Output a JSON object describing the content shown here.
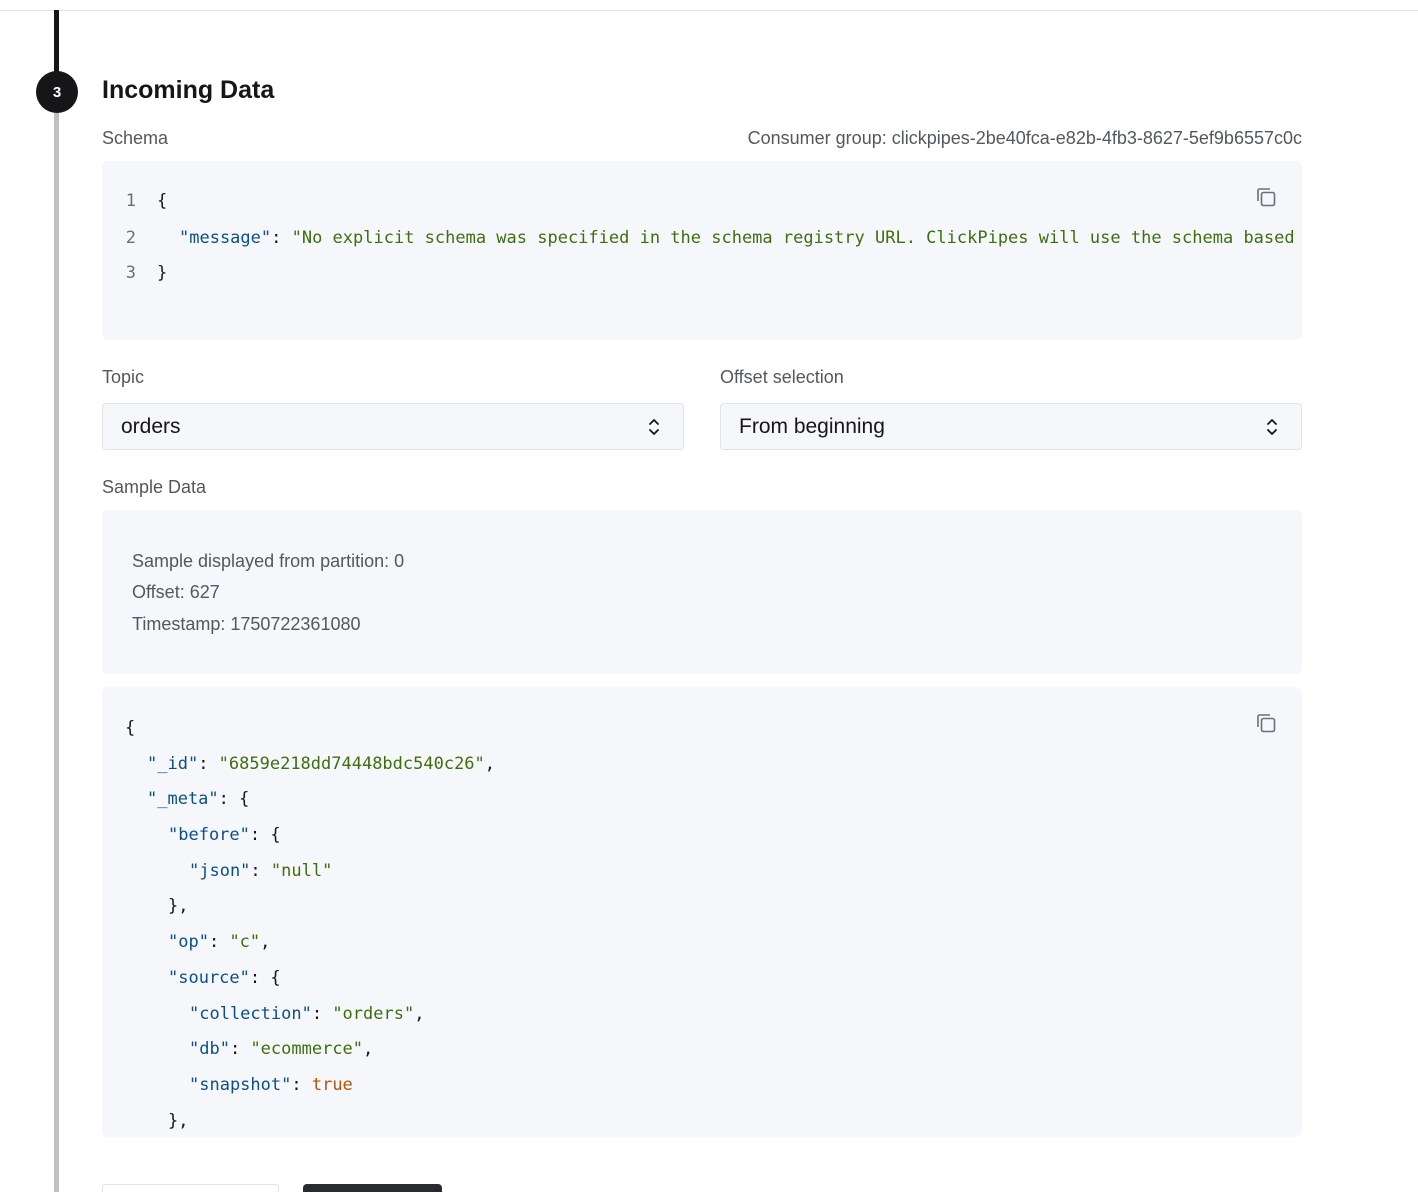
{
  "step": {
    "number": "3",
    "title": "Incoming Data"
  },
  "schema": {
    "label": "Schema",
    "consumer_group": "Consumer group: clickpipes-2be40fca-e82b-4fb3-8627-5ef9b6557c0c",
    "line_numbers": [
      "1",
      "2",
      "3"
    ],
    "open_brace": "{",
    "key": "\"message\"",
    "value": "\"No explicit schema was specified in the schema registry URL. ClickPipes will use the schema based on the sample data.\"",
    "close_brace": "}"
  },
  "topic": {
    "label": "Topic",
    "selected": "orders"
  },
  "offset": {
    "label": "Offset selection",
    "selected": "From beginning"
  },
  "sample": {
    "label": "Sample Data",
    "partition": "Sample displayed from partition: 0",
    "offset": "Offset: 627",
    "timestamp": "Timestamp: 1750722361080"
  },
  "sample_json": {
    "open": "{",
    "id_key": "\"_id\"",
    "id_value": "\"6859e218dd74448bdc540c26\"",
    "meta_key": "\"_meta\"",
    "before_key": "\"before\"",
    "json_key": "\"json\"",
    "json_value": "\"null\"",
    "close_obj_comma": "},",
    "op_key": "\"op\"",
    "op_value": "\"c\"",
    "source_key": "\"source\"",
    "collection_key": "\"collection\"",
    "collection_value": "\"orders\"",
    "db_key": "\"db\"",
    "db_value": "\"ecommerce\"",
    "snapshot_key": "\"snapshot\"",
    "snapshot_value": "true",
    "close_source": "},"
  },
  "icons": {
    "copy": "copy-icon",
    "chevron": "chevron-up-down-icon"
  }
}
